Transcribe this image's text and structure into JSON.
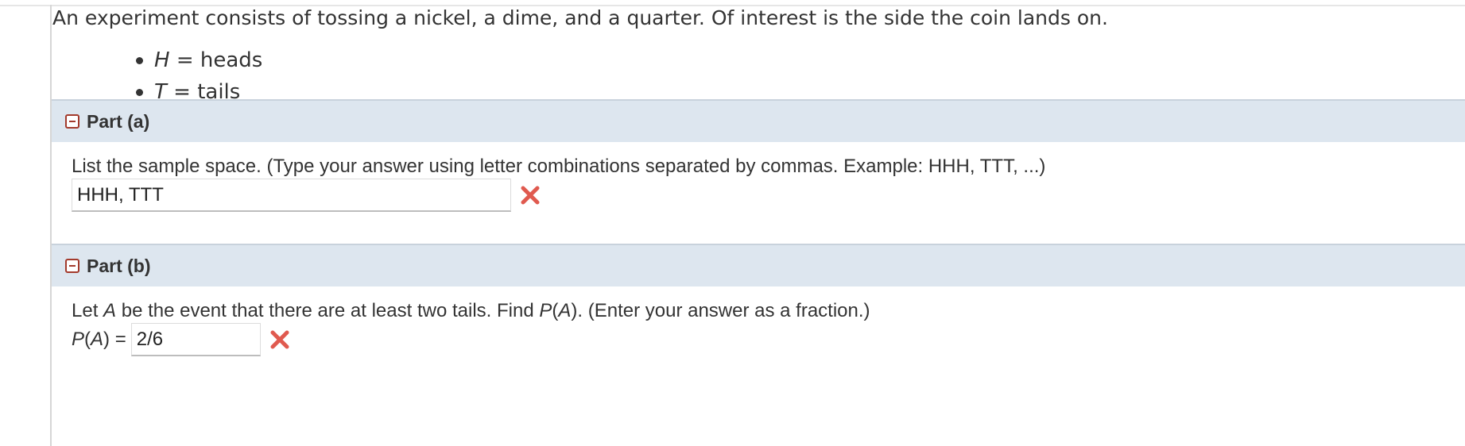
{
  "intro": "An experiment consists of tossing a nickel, a dime, and a quarter. Of interest is the side the coin lands on.",
  "definitions": [
    {
      "var": "H",
      "eq": " = heads"
    },
    {
      "var": "T",
      "eq": " = tails"
    }
  ],
  "part_a": {
    "title": "Part (a)",
    "question": "List the sample space. (Type your answer using letter combinations separated by commas. Example: HHH, TTT, ...)",
    "answer_value": "HHH, TTT",
    "status_icon": "red-x-icon"
  },
  "part_b": {
    "title": "Part (b)",
    "question_pre": "Let ",
    "question_var": "A",
    "question_mid": " be the event that there are at least two tails. Find ",
    "question_p": "P",
    "question_paren_open": "(",
    "question_var2": "A",
    "question_post": "). (Enter your answer as a fraction.)",
    "prefix_p": "P",
    "prefix_open": "(",
    "prefix_var": "A",
    "prefix_close": ") =",
    "answer_value": "2/6",
    "status_icon": "red-x-icon"
  },
  "colors": {
    "header_bg": "#dde6ef",
    "error_red": "#e05a4f",
    "collapse_border": "#a33a2c"
  }
}
